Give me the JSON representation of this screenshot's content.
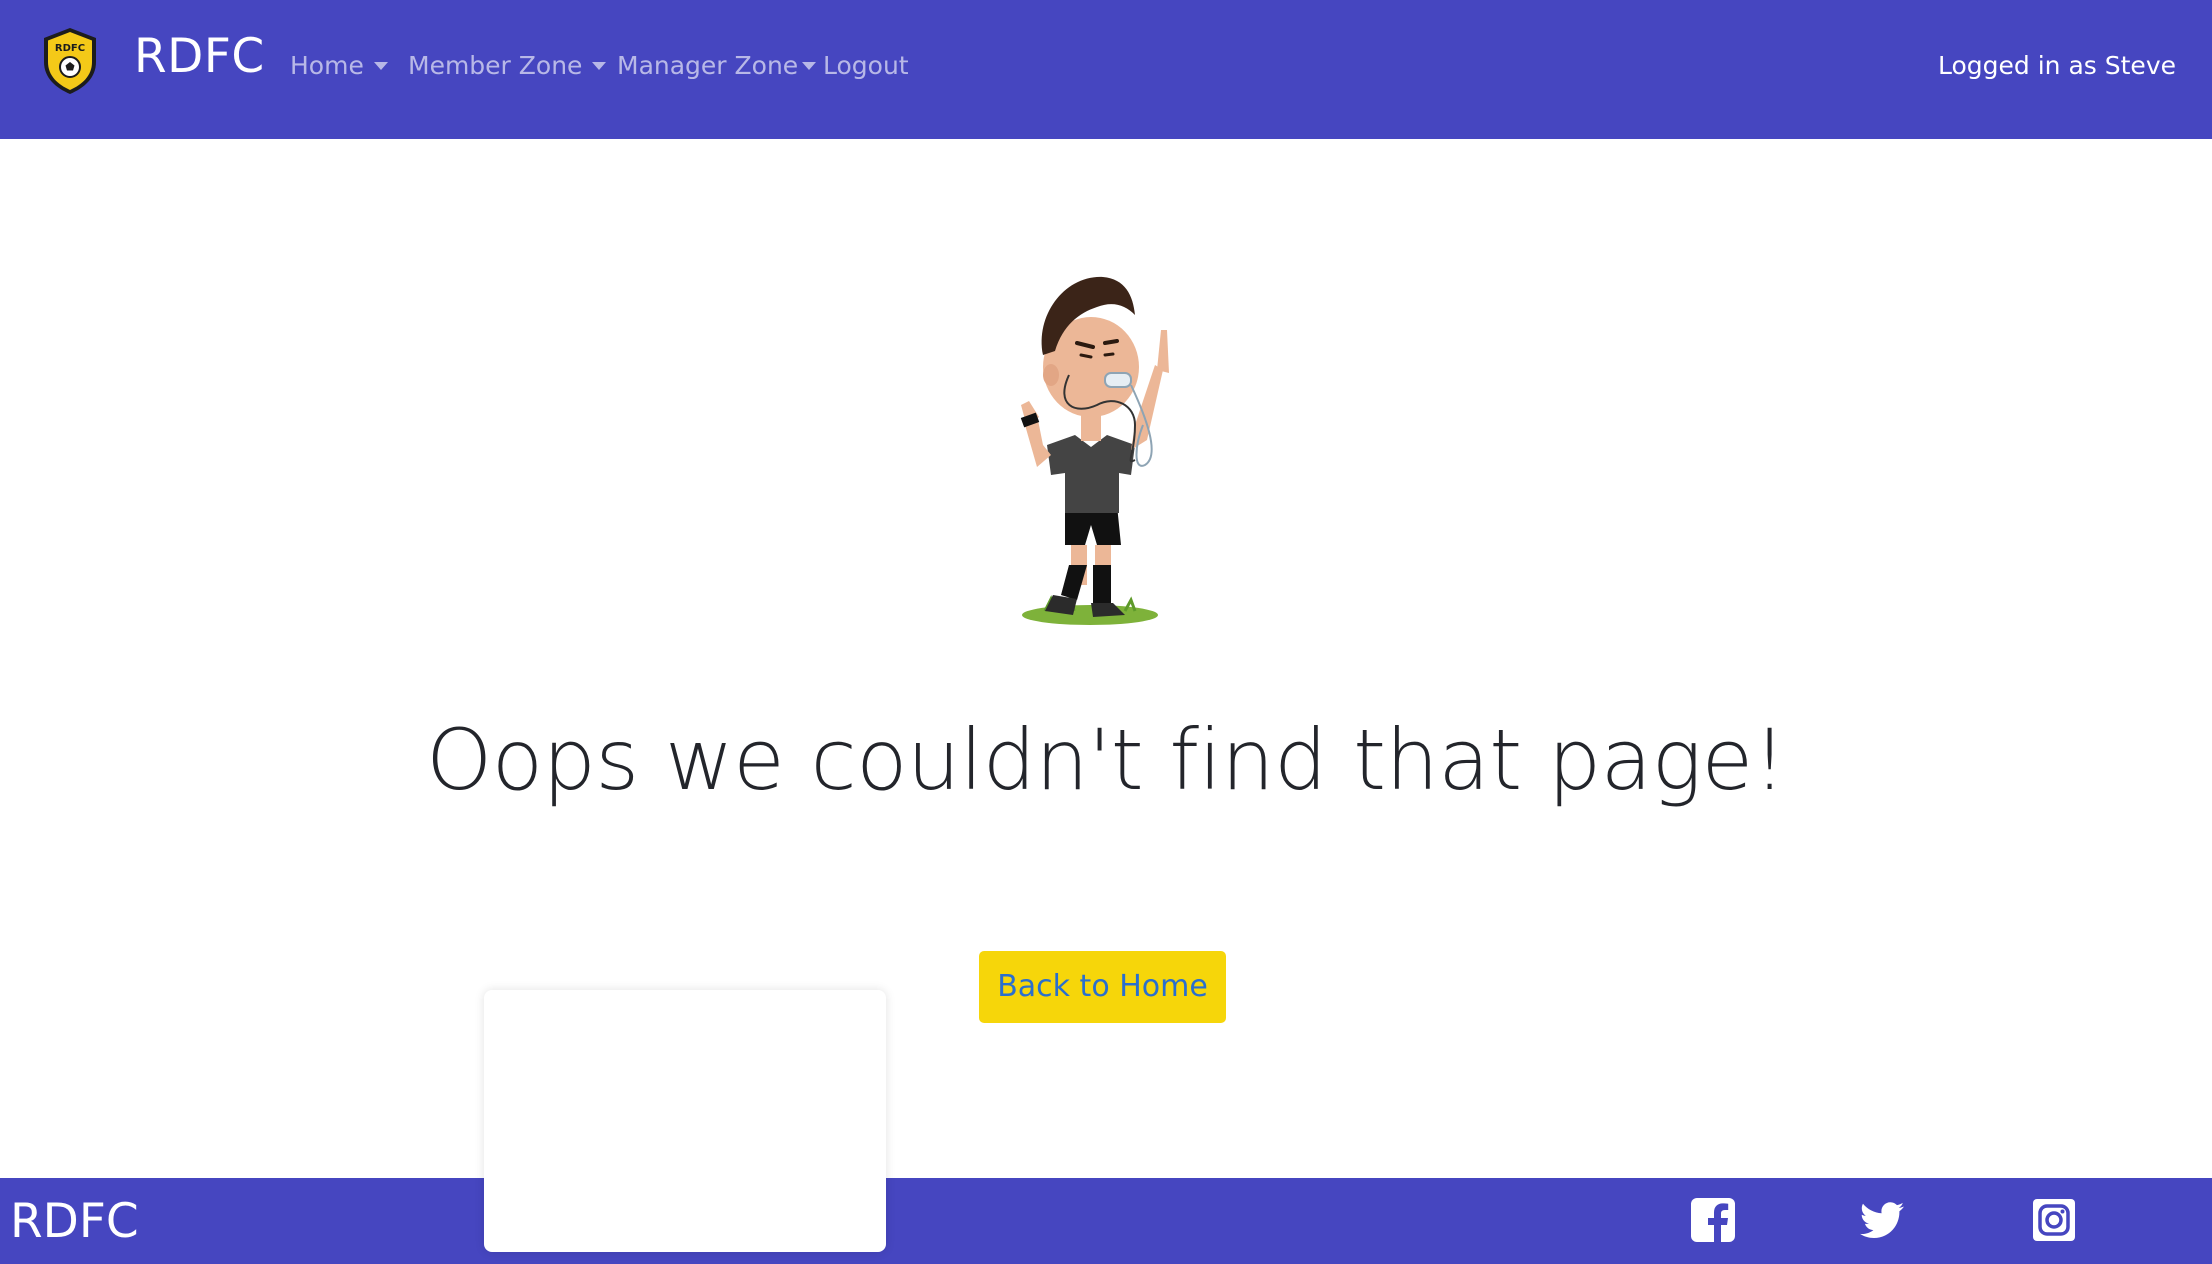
{
  "navbar": {
    "brand": "RDFC",
    "logo_text": "RDFC",
    "items": [
      {
        "label": "Home",
        "dropdown": true
      },
      {
        "label": "Member Zone",
        "dropdown": true
      },
      {
        "label": "Manager Zone",
        "dropdown": true
      },
      {
        "label": "Logout",
        "dropdown": false
      }
    ],
    "user_status": "Logged in as Steve"
  },
  "main": {
    "illustration": "referee-whistle-illustration",
    "headline": "Oops we couldn't find that page!",
    "back_button_label": "Back to Home"
  },
  "footer": {
    "brand": "RDFC",
    "social_icons": [
      "facebook-icon",
      "twitter-icon",
      "instagram-icon"
    ]
  },
  "colors": {
    "brand": "#4646c0",
    "button_bg": "#f6d60a",
    "button_text": "#2a6fce",
    "logo_yellow": "#f4c918"
  }
}
